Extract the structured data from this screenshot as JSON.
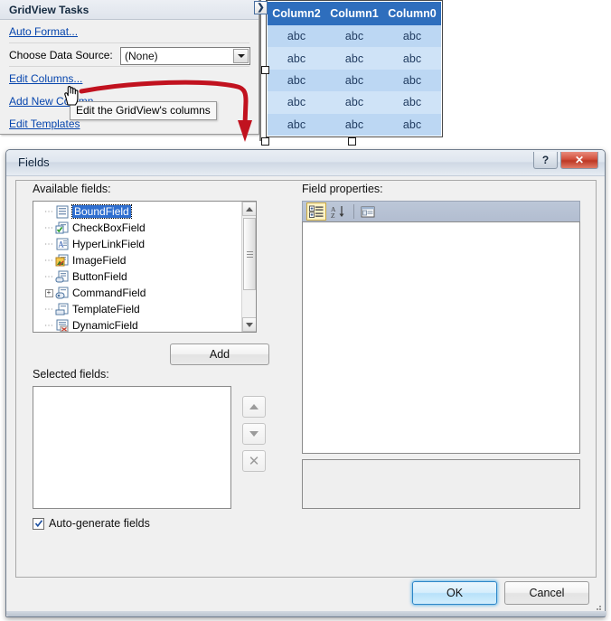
{
  "designer": {
    "smart_tag": {
      "title": "GridView Tasks",
      "auto_format": "Auto Format...",
      "data_source_label": "Choose Data Source:",
      "data_source_value": "(None)",
      "edit_columns": "Edit Columns...",
      "add_new_column": "Add New Column",
      "edit_templates": "Edit Templates",
      "expander_glyph": "❯"
    },
    "tooltip": "Edit the GridView's columns",
    "gridview": {
      "headers": [
        "Column2",
        "Column1",
        "Column0"
      ],
      "rows": [
        [
          "abc",
          "abc",
          "abc"
        ],
        [
          "abc",
          "abc",
          "abc"
        ],
        [
          "abc",
          "abc",
          "abc"
        ],
        [
          "abc",
          "abc",
          "abc"
        ],
        [
          "abc",
          "abc",
          "abc"
        ]
      ],
      "header_bg": "#2e6ebd",
      "row_bg": "#bcd7f3",
      "alt_row_bg": "#cfe3f7"
    },
    "annotation_color": "#c1121f"
  },
  "dialog": {
    "title": "Fields",
    "help_label": "?",
    "close_label": "✕",
    "available_label": "Available fields:",
    "available_fields": [
      {
        "label": "BoundField",
        "selected": true,
        "expandable": false
      },
      {
        "label": "CheckBoxField",
        "selected": false,
        "expandable": false
      },
      {
        "label": "HyperLinkField",
        "selected": false,
        "expandable": false
      },
      {
        "label": "ImageField",
        "selected": false,
        "expandable": false
      },
      {
        "label": "ButtonField",
        "selected": false,
        "expandable": false
      },
      {
        "label": "CommandField",
        "selected": false,
        "expandable": true
      },
      {
        "label": "TemplateField",
        "selected": false,
        "expandable": false
      },
      {
        "label": "DynamicField",
        "selected": false,
        "expandable": false
      }
    ],
    "add_button": "Add",
    "selected_label": "Selected fields:",
    "selected_fields": [],
    "move_up_icon": "arrow-up-icon",
    "move_down_icon": "arrow-down-icon",
    "remove_icon": "x-delete-icon",
    "autogenerate_label": "Auto-generate fields",
    "autogenerate_checked": true,
    "properties_label": "Field properties:",
    "property_toolbar": [
      {
        "icon": "categorized-view-icon",
        "active": true
      },
      {
        "icon": "alphabetical-sort-icon",
        "active": false
      },
      {
        "icon": "property-pages-icon",
        "active": false
      }
    ],
    "property_rows": [],
    "description_text": "",
    "ok_button": "OK",
    "cancel_button": "Cancel",
    "accent_color": "#2c86c8"
  }
}
